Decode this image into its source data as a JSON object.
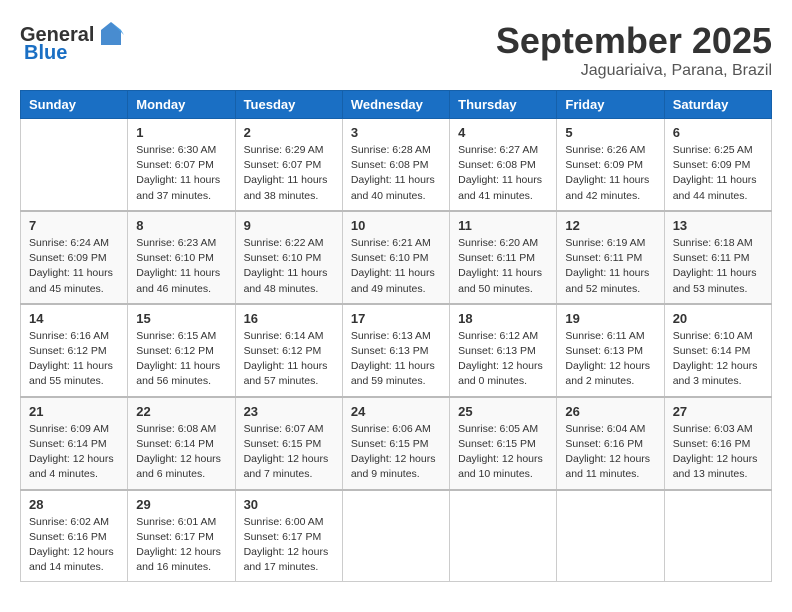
{
  "logo": {
    "general": "General",
    "blue": "Blue"
  },
  "title": {
    "month": "September 2025",
    "location": "Jaguariaiva, Parana, Brazil"
  },
  "header_days": [
    "Sunday",
    "Monday",
    "Tuesday",
    "Wednesday",
    "Thursday",
    "Friday",
    "Saturday"
  ],
  "weeks": [
    [
      {
        "day": "",
        "info": ""
      },
      {
        "day": "1",
        "info": "Sunrise: 6:30 AM\nSunset: 6:07 PM\nDaylight: 11 hours\nand 37 minutes."
      },
      {
        "day": "2",
        "info": "Sunrise: 6:29 AM\nSunset: 6:07 PM\nDaylight: 11 hours\nand 38 minutes."
      },
      {
        "day": "3",
        "info": "Sunrise: 6:28 AM\nSunset: 6:08 PM\nDaylight: 11 hours\nand 40 minutes."
      },
      {
        "day": "4",
        "info": "Sunrise: 6:27 AM\nSunset: 6:08 PM\nDaylight: 11 hours\nand 41 minutes."
      },
      {
        "day": "5",
        "info": "Sunrise: 6:26 AM\nSunset: 6:09 PM\nDaylight: 11 hours\nand 42 minutes."
      },
      {
        "day": "6",
        "info": "Sunrise: 6:25 AM\nSunset: 6:09 PM\nDaylight: 11 hours\nand 44 minutes."
      }
    ],
    [
      {
        "day": "7",
        "info": "Sunrise: 6:24 AM\nSunset: 6:09 PM\nDaylight: 11 hours\nand 45 minutes."
      },
      {
        "day": "8",
        "info": "Sunrise: 6:23 AM\nSunset: 6:10 PM\nDaylight: 11 hours\nand 46 minutes."
      },
      {
        "day": "9",
        "info": "Sunrise: 6:22 AM\nSunset: 6:10 PM\nDaylight: 11 hours\nand 48 minutes."
      },
      {
        "day": "10",
        "info": "Sunrise: 6:21 AM\nSunset: 6:10 PM\nDaylight: 11 hours\nand 49 minutes."
      },
      {
        "day": "11",
        "info": "Sunrise: 6:20 AM\nSunset: 6:11 PM\nDaylight: 11 hours\nand 50 minutes."
      },
      {
        "day": "12",
        "info": "Sunrise: 6:19 AM\nSunset: 6:11 PM\nDaylight: 11 hours\nand 52 minutes."
      },
      {
        "day": "13",
        "info": "Sunrise: 6:18 AM\nSunset: 6:11 PM\nDaylight: 11 hours\nand 53 minutes."
      }
    ],
    [
      {
        "day": "14",
        "info": "Sunrise: 6:16 AM\nSunset: 6:12 PM\nDaylight: 11 hours\nand 55 minutes."
      },
      {
        "day": "15",
        "info": "Sunrise: 6:15 AM\nSunset: 6:12 PM\nDaylight: 11 hours\nand 56 minutes."
      },
      {
        "day": "16",
        "info": "Sunrise: 6:14 AM\nSunset: 6:12 PM\nDaylight: 11 hours\nand 57 minutes."
      },
      {
        "day": "17",
        "info": "Sunrise: 6:13 AM\nSunset: 6:13 PM\nDaylight: 11 hours\nand 59 minutes."
      },
      {
        "day": "18",
        "info": "Sunrise: 6:12 AM\nSunset: 6:13 PM\nDaylight: 12 hours\nand 0 minutes."
      },
      {
        "day": "19",
        "info": "Sunrise: 6:11 AM\nSunset: 6:13 PM\nDaylight: 12 hours\nand 2 minutes."
      },
      {
        "day": "20",
        "info": "Sunrise: 6:10 AM\nSunset: 6:14 PM\nDaylight: 12 hours\nand 3 minutes."
      }
    ],
    [
      {
        "day": "21",
        "info": "Sunrise: 6:09 AM\nSunset: 6:14 PM\nDaylight: 12 hours\nand 4 minutes."
      },
      {
        "day": "22",
        "info": "Sunrise: 6:08 AM\nSunset: 6:14 PM\nDaylight: 12 hours\nand 6 minutes."
      },
      {
        "day": "23",
        "info": "Sunrise: 6:07 AM\nSunset: 6:15 PM\nDaylight: 12 hours\nand 7 minutes."
      },
      {
        "day": "24",
        "info": "Sunrise: 6:06 AM\nSunset: 6:15 PM\nDaylight: 12 hours\nand 9 minutes."
      },
      {
        "day": "25",
        "info": "Sunrise: 6:05 AM\nSunset: 6:15 PM\nDaylight: 12 hours\nand 10 minutes."
      },
      {
        "day": "26",
        "info": "Sunrise: 6:04 AM\nSunset: 6:16 PM\nDaylight: 12 hours\nand 11 minutes."
      },
      {
        "day": "27",
        "info": "Sunrise: 6:03 AM\nSunset: 6:16 PM\nDaylight: 12 hours\nand 13 minutes."
      }
    ],
    [
      {
        "day": "28",
        "info": "Sunrise: 6:02 AM\nSunset: 6:16 PM\nDaylight: 12 hours\nand 14 minutes."
      },
      {
        "day": "29",
        "info": "Sunrise: 6:01 AM\nSunset: 6:17 PM\nDaylight: 12 hours\nand 16 minutes."
      },
      {
        "day": "30",
        "info": "Sunrise: 6:00 AM\nSunset: 6:17 PM\nDaylight: 12 hours\nand 17 minutes."
      },
      {
        "day": "",
        "info": ""
      },
      {
        "day": "",
        "info": ""
      },
      {
        "day": "",
        "info": ""
      },
      {
        "day": "",
        "info": ""
      }
    ]
  ]
}
